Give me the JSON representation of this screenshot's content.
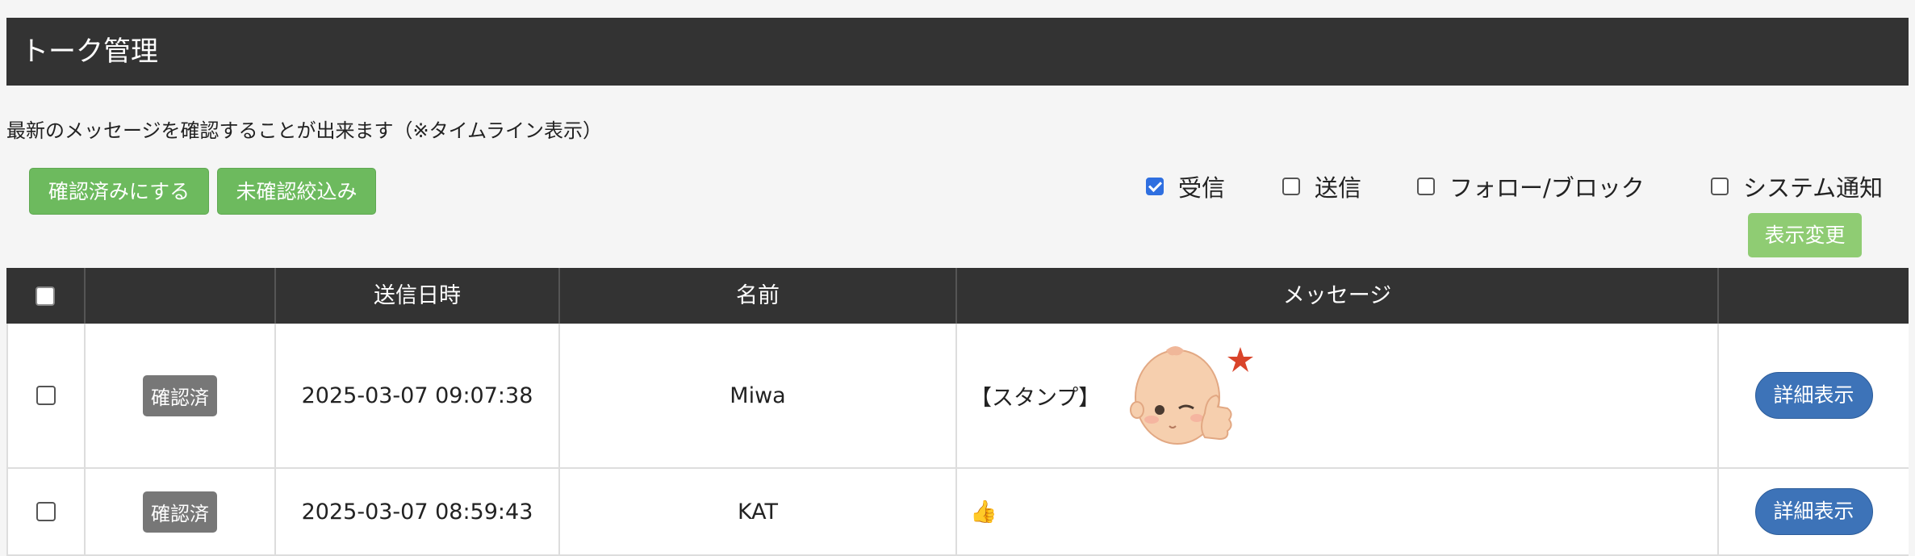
{
  "page": {
    "title": "トーク管理",
    "subtitle": "最新のメッセージを確認することが出来ます（※タイムライン表示）"
  },
  "actions": {
    "mark_read": "確認済みにする",
    "filter_unread": "未確認絞込み"
  },
  "filters": [
    {
      "label": "受信",
      "checked": true
    },
    {
      "label": "送信",
      "checked": false
    },
    {
      "label": "フォロー/ブロック",
      "checked": false
    },
    {
      "label": "システム通知",
      "checked": false
    }
  ],
  "apply_label": "表示変更",
  "table": {
    "headers": [
      "",
      "",
      "送信日時",
      "名前",
      "メッセージ",
      ""
    ],
    "rows": [
      {
        "status": "確認済",
        "datetime": "2025-03-07 09:07:38",
        "name": "Miwa",
        "message": "【スタンプ】",
        "detail": "詳細表示"
      },
      {
        "status": "確認済",
        "datetime": "2025-03-07 08:59:43",
        "name": "KAT",
        "message": "👍",
        "detail": "詳細表示"
      }
    ]
  },
  "colors": {
    "header_bg": "#333333",
    "green_button": "#6dba5e",
    "detail_button": "#3d73b8",
    "badge": "#777777"
  }
}
